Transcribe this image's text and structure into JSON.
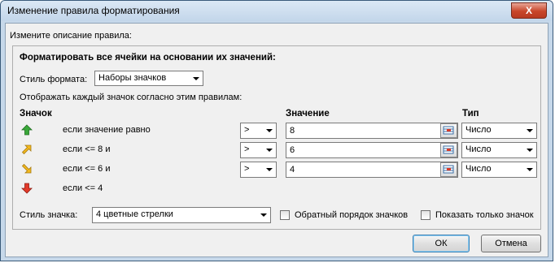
{
  "window": {
    "title": "Изменение правила форматирования",
    "close_label": "X"
  },
  "edit_label": "Измените описание правила:",
  "panel": {
    "heading": "Форматировать все ячейки на основании их значений:",
    "format_style_label": "Стиль формата:",
    "format_style_value": "Наборы значков",
    "rules_label": "Отображать каждый значок согласно этим правилам:",
    "col_icon": "Значок",
    "col_value": "Значение",
    "col_type": "Тип",
    "rows": [
      {
        "icon": "arrow-up-green",
        "text": "если значение равно",
        "operator": ">",
        "value": "8",
        "type": "Число"
      },
      {
        "icon": "arrow-up-right-yellow",
        "text": "если <= 8 и",
        "operator": ">",
        "value": "6",
        "type": "Число"
      },
      {
        "icon": "arrow-down-right-yellow",
        "text": "если <= 6 и",
        "operator": ">",
        "value": "4",
        "type": "Число"
      },
      {
        "icon": "arrow-down-red",
        "text": "если <= 4"
      }
    ],
    "icon_style_label": "Стиль значка:",
    "icon_style_value": "4 цветные стрелки",
    "reverse_order_label": "Обратный порядок значков",
    "reverse_order_checked": false,
    "show_icon_only_label": "Показать только значок",
    "show_icon_only_checked": false
  },
  "buttons": {
    "ok": "ОК",
    "cancel": "Отмена"
  }
}
